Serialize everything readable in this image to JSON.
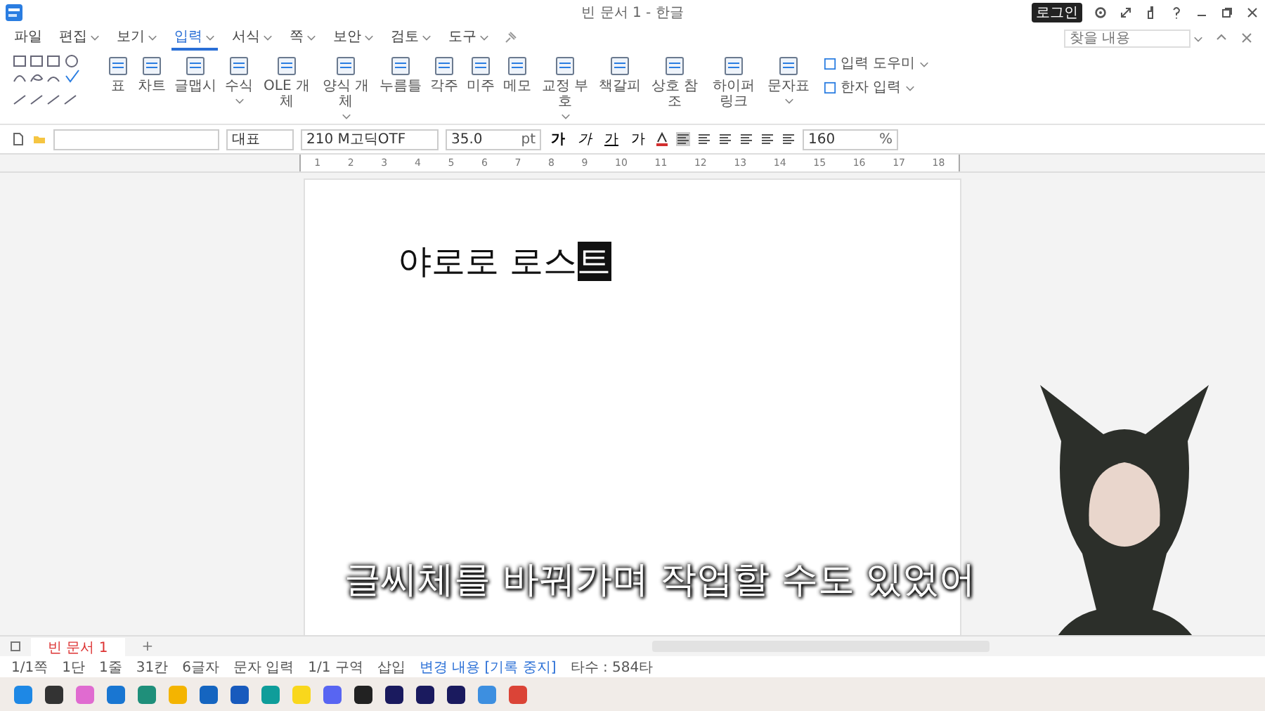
{
  "window": {
    "title": "빈 문서 1 - 한글",
    "login": "로그인"
  },
  "menu": [
    {
      "label": "파일",
      "selected": false,
      "dropdown": false
    },
    {
      "label": "편집",
      "selected": false,
      "dropdown": true
    },
    {
      "label": "보기",
      "selected": false,
      "dropdown": true
    },
    {
      "label": "입력",
      "selected": true,
      "dropdown": true
    },
    {
      "label": "서식",
      "selected": false,
      "dropdown": true
    },
    {
      "label": "쪽",
      "selected": false,
      "dropdown": true
    },
    {
      "label": "보안",
      "selected": false,
      "dropdown": true
    },
    {
      "label": "검토",
      "selected": false,
      "dropdown": true
    },
    {
      "label": "도구",
      "selected": false,
      "dropdown": true
    }
  ],
  "search": {
    "placeholder": "찾을 내용"
  },
  "ribbon": {
    "items": [
      {
        "label": "표",
        "dropdown": false
      },
      {
        "label": "차트",
        "dropdown": false
      },
      {
        "label": "글맵시",
        "dropdown": false
      },
      {
        "label": "수식",
        "dropdown": true
      },
      {
        "label": "OLE 개체",
        "dropdown": false
      },
      {
        "label": "양식 개체",
        "dropdown": true
      },
      {
        "label": "누름틀",
        "dropdown": false
      },
      {
        "label": "각주",
        "dropdown": false
      },
      {
        "label": "미주",
        "dropdown": false
      },
      {
        "label": "메모",
        "dropdown": false
      },
      {
        "label": "교정 부호",
        "dropdown": true
      },
      {
        "label": "책갈피",
        "dropdown": false
      },
      {
        "label": "상호 참조",
        "dropdown": false
      },
      {
        "label": "하이퍼링크",
        "dropdown": false
      },
      {
        "label": "문자표",
        "dropdown": true
      }
    ],
    "side": [
      "입력 도우미",
      "한자 입력"
    ]
  },
  "format": {
    "style": "대표",
    "font": "210 M고딕OTF",
    "size": "35.0",
    "unit": "pt",
    "buttons": [
      "가",
      "가",
      "가",
      "가"
    ],
    "line_spacing": "160",
    "line_unit": "%"
  },
  "ruler": [
    "1",
    "2",
    "3",
    "4",
    "5",
    "6",
    "7",
    "8",
    "9",
    "10",
    "11",
    "12",
    "13",
    "14",
    "15",
    "16",
    "17",
    "18"
  ],
  "document": {
    "text": "야로로 로스",
    "selected_text": "트"
  },
  "caption": "글씨체를 바꿔가며 작업할 수도 있었어",
  "tabs": [
    {
      "label": "빈 문서 1",
      "selected": true
    }
  ],
  "add_tab": "+",
  "status_bar": [
    "1/1쪽",
    "1단",
    "1줄",
    "31칸",
    "6글자",
    "문자 입력",
    "1/1 구역",
    "삽입",
    "변경 내용 [기록 중지]",
    "타수 : 584타"
  ],
  "taskbar": [
    {
      "color": "#1e88e5"
    },
    {
      "color": "#333333"
    },
    {
      "color": "#e06bd0"
    },
    {
      "color": "#1976d2"
    },
    {
      "color": "#1f8f7a"
    },
    {
      "color": "#f4b400"
    },
    {
      "color": "#1565c0"
    },
    {
      "color": "#185abd"
    },
    {
      "color": "#0f9d9a"
    },
    {
      "color": "#f9d71c"
    },
    {
      "color": "#5865f2"
    },
    {
      "color": "#222222"
    },
    {
      "color": "#1a1a5e"
    },
    {
      "color": "#1a1a5e"
    },
    {
      "color": "#1a1a5e"
    },
    {
      "color": "#3d8fe0"
    },
    {
      "color": "#db4437"
    }
  ]
}
